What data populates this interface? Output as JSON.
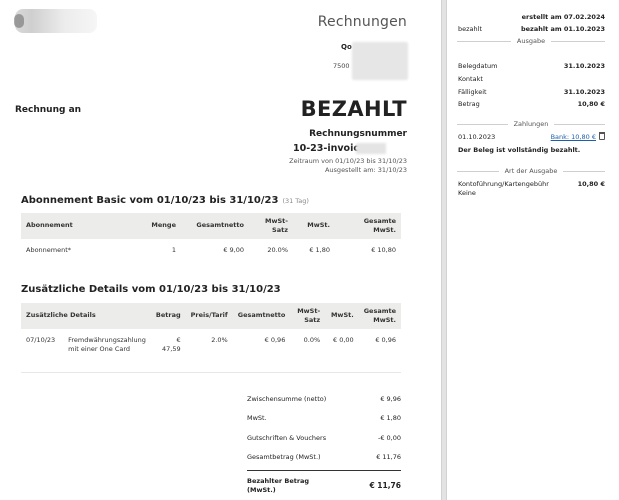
{
  "invoice": {
    "doc_title": "Rechnungen",
    "issuer_name": "Qo",
    "issuer_zip": "7500",
    "bill_to": "Rechnung an",
    "status_stamp": "BEZAHLT",
    "number_label": "Rechnungsnummer",
    "number": "10-23-invoice-",
    "period": "Zeitraum von 01/10/23 bis 31/10/23",
    "issued": "Ausgestellt am: 31/10/23"
  },
  "subscription": {
    "title": "Abonnement Basic vom 01/10/23 bis 31/10/23",
    "days": "(31 Tag)",
    "headers": [
      "Abonnement",
      "Menge",
      "Gesamtnetto",
      "MwSt-Satz",
      "MwSt.",
      "Gesamte MwSt."
    ],
    "rows": [
      [
        "Abonnement*",
        "1",
        "€ 9,00",
        "20.0%",
        "€ 1,80",
        "€ 10,80"
      ]
    ]
  },
  "details": {
    "title": "Zusätzliche Details vom 01/10/23 bis 31/10/23",
    "headers": [
      "Zusätzliche Details",
      "Betrag",
      "Preis/Tarif",
      "Gesamtnetto",
      "MwSt-Satz",
      "MwSt.",
      "Gesamte MwSt."
    ],
    "rows": [
      [
        "07/10/23",
        "Fremdwährungszahlung mit einer One Card",
        "€ 47,59",
        "2.0%",
        "€ 0,96",
        "0.0%",
        "€ 0,00",
        "€ 0,96"
      ]
    ]
  },
  "totals": {
    "rows": [
      {
        "label": "Zwischensumme (netto)",
        "value": "€ 9,96"
      },
      {
        "label": "MwSt.",
        "value": "€ 1,80"
      },
      {
        "label": "Gutschriften & Vouchers",
        "value": "-€ 0,00"
      },
      {
        "label": "Gesamtbetrag (MwSt.)",
        "value": "€ 11,76"
      }
    ],
    "paid_label": "Bezahlter Betrag (MwSt.)",
    "paid_value": "€ 11,76"
  },
  "sidebar": {
    "created": "erstellt am 07.02.2024",
    "status_label": "bezahlt",
    "paid_on": "bezahlt am 01.10.2023",
    "section_expense": "Ausgabe",
    "fields": [
      {
        "label": "Belegdatum",
        "value": "31.10.2023"
      },
      {
        "label": "Kontakt",
        "value": ""
      },
      {
        "label": "Fälligkeit",
        "value": "31.10.2023"
      },
      {
        "label": "Betrag",
        "value": "10,80 €"
      }
    ],
    "section_payments": "Zahlungen",
    "payment_date": "01.10.2023",
    "payment_link": "Bank: 10,80 €",
    "payment_note": "Der Beleg ist vollständig bezahlt.",
    "section_type": "Art der Ausgabe",
    "expense_category": "Kontoführung/Kartengebühr",
    "expense_sub": "Keine",
    "expense_amount": "10,80 €"
  }
}
